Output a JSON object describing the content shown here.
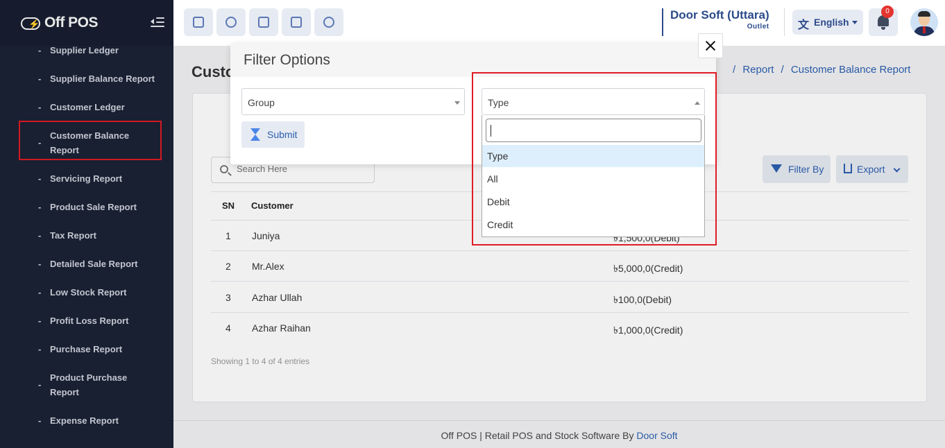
{
  "app": {
    "logo_text": "Off POS"
  },
  "sidebar": {
    "items": [
      {
        "label": "Supplier Ledger"
      },
      {
        "label": "Supplier Balance Report"
      },
      {
        "label": "Customer Ledger"
      },
      {
        "label": "Customer Balance Report"
      },
      {
        "label": "Servicing Report"
      },
      {
        "label": "Product Sale Report"
      },
      {
        "label": "Tax Report"
      },
      {
        "label": "Detailed Sale Report"
      },
      {
        "label": "Low Stock Report"
      },
      {
        "label": "Profit Loss Report"
      },
      {
        "label": "Purchase Report"
      },
      {
        "label": "Product Purchase Report"
      },
      {
        "label": "Expense Report"
      }
    ],
    "dash": "-"
  },
  "header": {
    "outlet_name": "Door Soft (Uttara)",
    "outlet_label": "Outlet",
    "language": "English",
    "notification_count": "0"
  },
  "page": {
    "title": "Customer Balance Report",
    "title_visible": "Custo",
    "breadcrumb": [
      "Report",
      "Customer Balance Report"
    ],
    "breadcrumb_sep": "/"
  },
  "toolbar": {
    "search_placeholder": "Search Here",
    "filter_label": "Filter By",
    "export_label": "Export"
  },
  "table": {
    "columns": [
      "SN",
      "Customer"
    ],
    "rows": [
      {
        "sn": "1",
        "customer": "Juniya",
        "balance": "৳1,500,0(Debit)"
      },
      {
        "sn": "2",
        "customer": "Mr.Alex",
        "balance": "৳5,000,0(Credit)"
      },
      {
        "sn": "3",
        "customer": "Azhar Ullah",
        "balance": "৳100,0(Debit)"
      },
      {
        "sn": "4",
        "customer": "Azhar Raihan",
        "balance": "৳1,000,0(Credit)"
      }
    ],
    "info": "Showing 1 to 4 of 4 entries"
  },
  "modal": {
    "title": "Filter Options",
    "group_select": "Group",
    "type_select": "Type",
    "submit_label": "Submit",
    "type_options": [
      "Type",
      "All",
      "Debit",
      "Credit"
    ],
    "search_value": ""
  },
  "footer": {
    "text": "Off POS | Retail POS and Stock Software By ",
    "link": "Door Soft"
  },
  "colors": {
    "sidebar_bg": "#1b2236",
    "accent": "#2b5fb0",
    "highlight": "#e01b24"
  }
}
